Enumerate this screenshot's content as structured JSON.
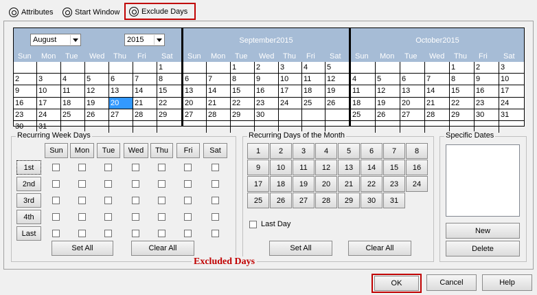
{
  "tabs": [
    {
      "label": "Attributes",
      "icon": "attributes-icon"
    },
    {
      "label": "Start Window",
      "icon": "start-window-icon"
    },
    {
      "label": "Exclude Days",
      "icon": "exclude-days-icon"
    }
  ],
  "calendar": {
    "month_select": "August",
    "year_select": "2015",
    "dow": [
      "Sun",
      "Mon",
      "Tue",
      "Wed",
      "Thu",
      "Fri",
      "Sat"
    ],
    "months": [
      {
        "title": "",
        "rows": [
          [
            "",
            "",
            "",
            "",
            "",
            "",
            "1"
          ],
          [
            "2",
            "3",
            "4",
            "5",
            "6",
            "7",
            "8"
          ],
          [
            "9",
            "10",
            "11",
            "12",
            "13",
            "14",
            "15"
          ],
          [
            "16",
            "17",
            "18",
            "19",
            "20",
            "21",
            "22"
          ],
          [
            "23",
            "24",
            "25",
            "26",
            "27",
            "28",
            "29"
          ],
          [
            "30",
            "31",
            "",
            "",
            "",
            "",
            ""
          ]
        ]
      },
      {
        "title": "September2015",
        "rows": [
          [
            "",
            "",
            "1",
            "2",
            "3",
            "4",
            "5"
          ],
          [
            "6",
            "7",
            "8",
            "9",
            "10",
            "11",
            "12"
          ],
          [
            "13",
            "14",
            "15",
            "16",
            "17",
            "18",
            "19"
          ],
          [
            "20",
            "21",
            "22",
            "23",
            "24",
            "25",
            "26"
          ],
          [
            "27",
            "28",
            "29",
            "30",
            "",
            "",
            ""
          ],
          [
            "",
            "",
            "",
            "",
            "",
            "",
            ""
          ]
        ]
      },
      {
        "title": "October2015",
        "rows": [
          [
            "",
            "",
            "",
            "",
            "1",
            "2",
            "3"
          ],
          [
            "4",
            "5",
            "6",
            "7",
            "8",
            "9",
            "10"
          ],
          [
            "11",
            "12",
            "13",
            "14",
            "15",
            "16",
            "17"
          ],
          [
            "18",
            "19",
            "20",
            "21",
            "22",
            "23",
            "24"
          ],
          [
            "25",
            "26",
            "27",
            "28",
            "29",
            "30",
            "31"
          ],
          [
            "",
            "",
            "",
            "",
            "",
            "",
            ""
          ]
        ]
      }
    ],
    "selected": "20"
  },
  "recurring_week": {
    "title": "Recurring Week Days",
    "days": [
      "Sun",
      "Mon",
      "Tue",
      "Wed",
      "Thu",
      "Fri",
      "Sat"
    ],
    "weeks": [
      "1st",
      "2nd",
      "3rd",
      "4th",
      "Last"
    ],
    "set_all": "Set All",
    "clear_all": "Clear All"
  },
  "recurring_month": {
    "title": "Recurring Days of the Month",
    "days": [
      "1",
      "2",
      "3",
      "4",
      "5",
      "6",
      "7",
      "8",
      "9",
      "10",
      "11",
      "12",
      "13",
      "14",
      "15",
      "16",
      "17",
      "18",
      "19",
      "20",
      "21",
      "22",
      "23",
      "24",
      "25",
      "26",
      "27",
      "28",
      "29",
      "30",
      "31"
    ],
    "last_day": "Last Day",
    "set_all": "Set All",
    "clear_all": "Clear All"
  },
  "specific": {
    "title": "Specific Dates",
    "new": "New",
    "delete": "Delete"
  },
  "annotation": "Excluded Days",
  "footer": {
    "ok": "OK",
    "cancel": "Cancel",
    "help": "Help"
  }
}
